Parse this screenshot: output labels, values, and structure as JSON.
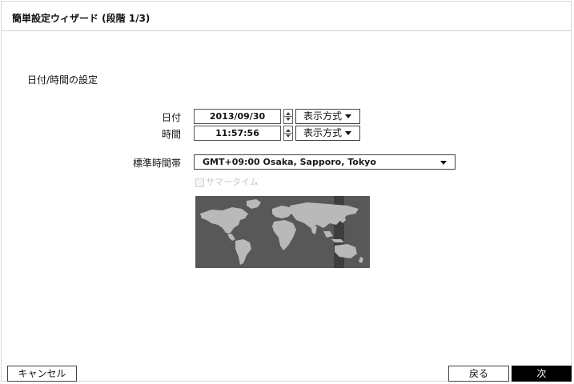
{
  "wizard": {
    "title": "簡単設定ウィザード (段階 1/3)"
  },
  "section": {
    "title": "日付/時間の設定"
  },
  "date": {
    "label": "日付",
    "value": "2013/09/30",
    "format_button": "表示方式"
  },
  "time": {
    "label": "時間",
    "value": "11:57:56",
    "format_button": "表示方式"
  },
  "timezone": {
    "label": "標準時間帯",
    "value": "GMT+09:00  Osaka, Sapporo, Tokyo"
  },
  "dst": {
    "label": "サマータイム",
    "checked": false,
    "enabled": false
  },
  "map": {
    "ocean_color": "#585858",
    "land_color": "#b9b9b9",
    "highlight_color": "#3a3a3a"
  },
  "footer": {
    "cancel": "キャンセル",
    "back": "戻る",
    "next": "次"
  }
}
